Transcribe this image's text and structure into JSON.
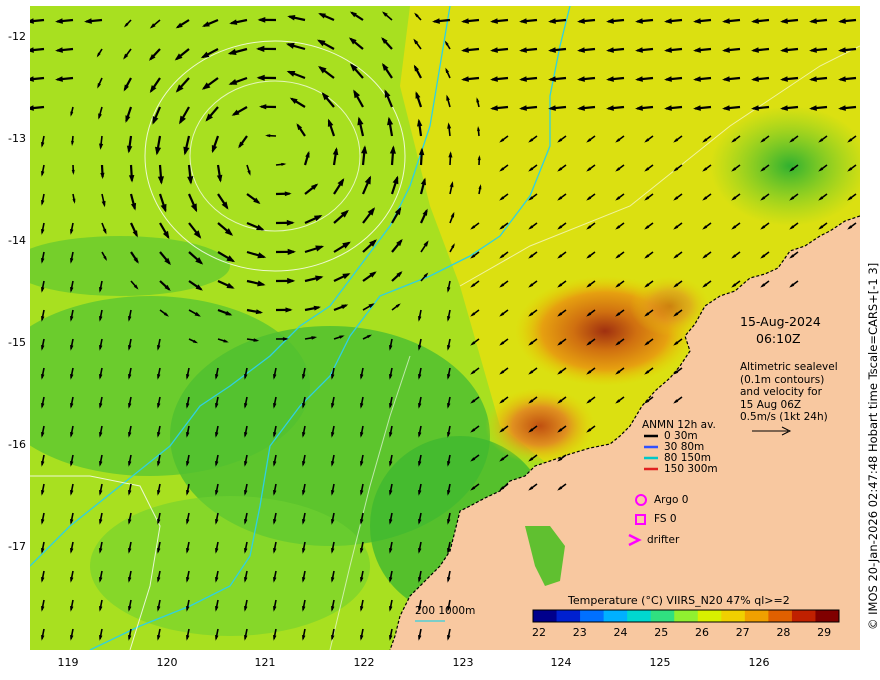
{
  "map": {
    "lon_ticks": [
      "119",
      "120",
      "121",
      "122",
      "123",
      "124",
      "125",
      "126"
    ],
    "lat_ticks": [
      "-12",
      "-13",
      "-14",
      "-15",
      "-16",
      "-17"
    ],
    "date": "15-Aug-2024",
    "time": "06:10Z",
    "altimetry_lines": [
      "Altimetric sealevel",
      "(0.1m contours)",
      "and velocity for",
      "15 Aug 06Z",
      "0.5m/s (1kt 24h)"
    ],
    "anmn_title": "ANMN 12h av.",
    "anmn_items": [
      {
        "label": "0 30m",
        "color": "#000000"
      },
      {
        "label": "30 80m",
        "color": "#3050ff"
      },
      {
        "label": "80 150m",
        "color": "#00c8c8"
      },
      {
        "label": "150 300m",
        "color": "#e02020"
      }
    ],
    "argo_label": "Argo 0",
    "fs_label": "FS 0",
    "drifter_label": "drifter",
    "isobath_label": "200  1000m",
    "colorbar_title": "Temperature (°C) VIIRS_N20 47% ql>=2",
    "colorbar_ticks": [
      "22",
      "23",
      "24",
      "25",
      "26",
      "27",
      "28",
      "29"
    ],
    "credit": "© IMOS 20-Jan-2026 02:47:48 Hobart time Tscale=CARS+[-1 3]",
    "colors": {
      "land": "#f8c8a0",
      "warm_sst": "#e6e600",
      "cool_sst": "#60cc30",
      "hot_sst": "#d07010",
      "isobath": "#30d0e0",
      "marker": "#ff00ff"
    }
  }
}
